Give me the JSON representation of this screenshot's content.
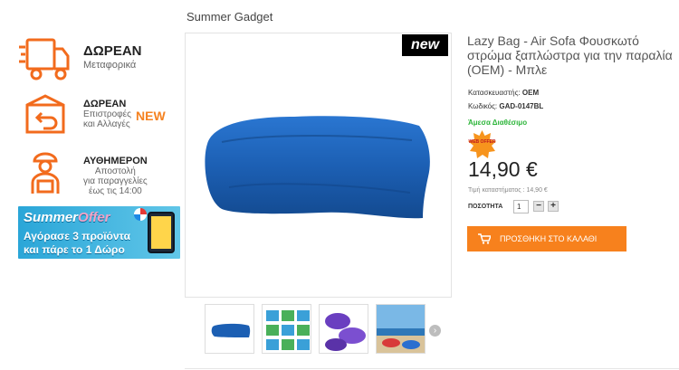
{
  "breadcrumb": "Summer Gadget",
  "promos": {
    "shipping": {
      "title": "ΔΩΡΕΑΝ",
      "subtitle": "Μεταφορικά"
    },
    "returns": {
      "title": "ΔΩΡΕΑΝ",
      "line1": "Επιστροφές",
      "line2": "και Αλλαγές",
      "badge": "NEW"
    },
    "same_day": {
      "title": "ΑΥΘΗΜΕΡΟΝ",
      "line1": "Αποστολή",
      "line2": "για παραγγελίες",
      "line3": "έως τις 14:00"
    }
  },
  "banner": {
    "title_a": "Summer",
    "title_b": "Offer",
    "line1": "Αγόρασε 3 προϊόντα",
    "line2": "και πάρε το 1 Δώρο"
  },
  "product": {
    "badge": "new",
    "title": "Lazy Bag - Air Sofa Φουσκωτό στρώμα ξαπλώστρα για την παραλία (OEM) - Μπλε",
    "manufacturer_label": "Κατασκευαστής:",
    "manufacturer": "OEM",
    "code_label": "Κωδικός:",
    "code": "GAD-0147BL",
    "availability": "Άμεσα Διαθέσιμο",
    "offer_badge": "WEB OFFER",
    "price": "14,90 €",
    "retail_price": "Τιμή καταστήματος : 14,90 €",
    "quantity_label": "ΠΟΣΟΤΗΤΑ",
    "quantity": "1",
    "minus": "−",
    "plus": "+",
    "add_to_cart": "ΠΡΟΣΘΗΚΗ ΣΤΟ ΚΑΛΑΘΙ",
    "next_arrow": "›"
  },
  "colors": {
    "accent": "#f7811d",
    "available": "#2db53a",
    "product": "#1c5fb3"
  },
  "icons": [
    "truck-icon",
    "return-box-icon",
    "delivery-person-icon",
    "cart-icon",
    "chevron-right-icon"
  ]
}
